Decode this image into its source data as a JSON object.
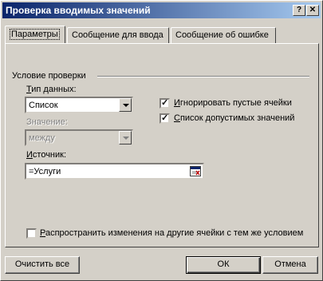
{
  "window": {
    "title": "Проверка вводимых значений",
    "close_glyph": "✕"
  },
  "tabs": [
    {
      "label": "Параметры",
      "active": true
    },
    {
      "label": "Сообщение для ввода",
      "active": false
    },
    {
      "label": "Сообщение об ошибке",
      "active": false
    }
  ],
  "settings": {
    "group_label": "Условие проверки",
    "data_type": {
      "label_prefix": "Т",
      "label_rest": "ип данных:",
      "value": "Список"
    },
    "condition": {
      "label": "Значение:",
      "value": "между"
    },
    "ignore_blank": {
      "label_prefix": "И",
      "label_rest": "гнорировать пустые ячейки",
      "checked": true,
      "check_glyph": "✓"
    },
    "in_cell_dropdown": {
      "label_prefix": "С",
      "label_rest": "писок допустимых значений",
      "checked": true,
      "check_glyph": "✓"
    },
    "source": {
      "label_prefix": "И",
      "label_rest": "сточник:",
      "value": "=Услуги"
    },
    "apply_all": {
      "label_prefix": "Р",
      "label_rest": "аспространить изменения на другие ячейки с тем же условием",
      "checked": false
    }
  },
  "buttons": {
    "clear_all": "Очистить все",
    "ok": "ОК",
    "cancel": "Отмена"
  },
  "colors": {
    "titlebar_start": "#0a246a",
    "titlebar_end": "#a6caf0",
    "face": "#d4d0c8"
  }
}
